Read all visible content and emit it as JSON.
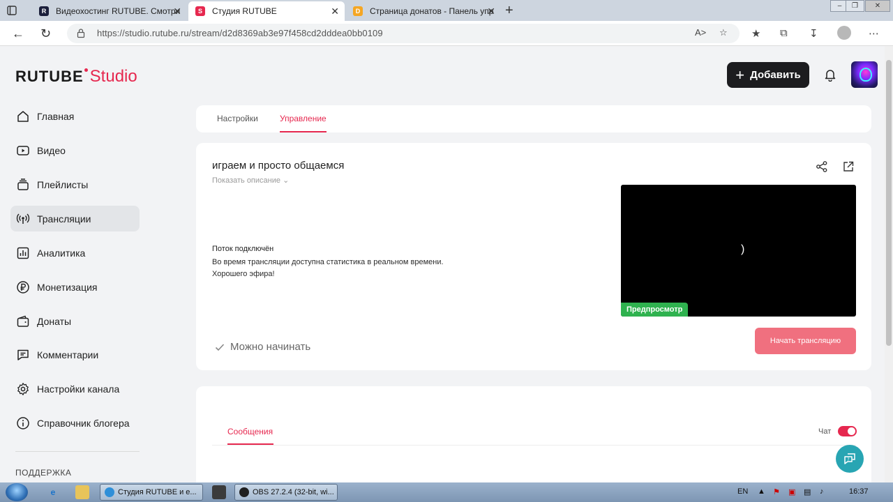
{
  "browser": {
    "tabs": [
      {
        "title": "Видеохостинг RUTUBE. Смотрит",
        "favicon_letter": "R",
        "favicon_color": "#1b1f3b",
        "active": false
      },
      {
        "title": "Студия RUTUBE",
        "favicon_letter": "S",
        "favicon_color": "#e6284f",
        "active": true
      },
      {
        "title": "Страница донатов - Панель упр",
        "favicon_letter": "D",
        "favicon_color": "#f5a623",
        "active": false
      }
    ],
    "new_tab_glyph": "+",
    "close_glyph": "✕",
    "url": "https://studio.rutube.ru/stream/d2d8369ab3e97f458cd2dddea0bb0109"
  },
  "header": {
    "logo_main": "RUTUBE",
    "logo_studio": "Studio",
    "add_label": "Добавить"
  },
  "sidebar": {
    "items": [
      {
        "label": "Главная",
        "icon": "home-icon"
      },
      {
        "label": "Видео",
        "icon": "video-icon"
      },
      {
        "label": "Плейлисты",
        "icon": "playlist-icon"
      },
      {
        "label": "Трансляции",
        "icon": "broadcast-icon",
        "active": true
      },
      {
        "label": "Аналитика",
        "icon": "analytics-icon"
      },
      {
        "label": "Монетизация",
        "icon": "ruble-icon"
      },
      {
        "label": "Донаты",
        "icon": "wallet-icon"
      },
      {
        "label": "Комментарии",
        "icon": "comment-icon"
      },
      {
        "label": "Настройки канала",
        "icon": "gear-icon"
      },
      {
        "label": "Справочник блогера",
        "icon": "info-icon"
      }
    ],
    "support_label": "ПОДДЕРЖКА"
  },
  "page_tabs": [
    {
      "label": "Настройки",
      "active": false
    },
    {
      "label": "Управление",
      "active": true
    }
  ],
  "stream": {
    "title": "играем и просто общаемся",
    "show_description": "Показать описание",
    "status_title": "Поток подключён",
    "status_lines": [
      "Во время трансляции доступна статистика в реальном времени.",
      "Хорошего эфира!"
    ],
    "preview_badge": "Предпросмотр",
    "preview_spinner": ")",
    "ready_label": "Можно начинать",
    "start_button": "Начать трансляцию"
  },
  "chat": {
    "tab_label": "Сообщения",
    "toggle_label": "Чат",
    "toggle_on": true
  },
  "colors": {
    "accent": "#e6284f",
    "start_button": "#f0707f",
    "preview_badge": "#2fb24f",
    "help_button": "#28a5b3"
  },
  "taskbar": {
    "tasks": [
      {
        "label": "Студия RUTUBE и е...",
        "icon": "edge-icon"
      },
      {
        "label": "OBS 27.2.4 (32-bit, wi...",
        "icon": "obs-icon"
      }
    ],
    "language": "EN",
    "time": "16:37"
  }
}
